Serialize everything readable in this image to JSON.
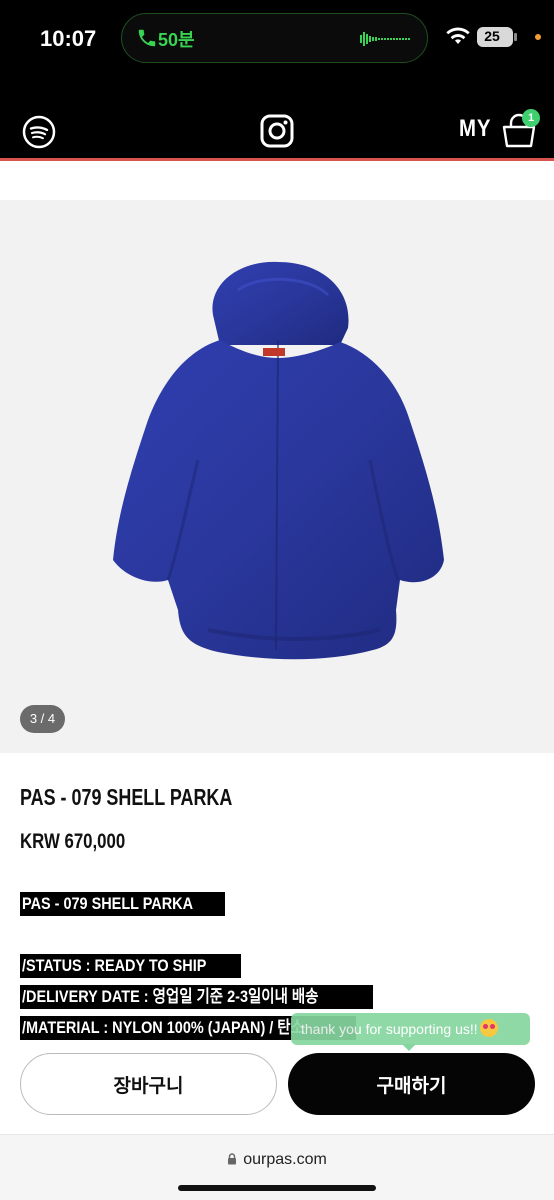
{
  "status_bar": {
    "time": "10:07",
    "call_duration": "50분",
    "battery": "25",
    "colors": {
      "call": "#39d353",
      "dot": "#f39c33"
    }
  },
  "header": {
    "my_label": "MY",
    "cart_count": "1",
    "icons": [
      "spotify-icon",
      "instagram-icon",
      "shopping-bag-icon"
    ]
  },
  "product": {
    "image_counter": "3 / 4",
    "title": "PAS - 079 SHELL PARKA",
    "price": "KRW 670,000",
    "description": {
      "line1": "PAS - 079 SHELL PARKA",
      "status": "/STATUS : READY TO SHIP",
      "delivery": "/DELIVERY DATE : 영업일 기준 2-3일이내  배송",
      "material": "/MATERIAL : NYLON 100% (JAPAN) / 탄소"
    },
    "color": "#2b3a9e"
  },
  "tooltip": {
    "text": "thank you for supporting us!!"
  },
  "actions": {
    "cart_label": "장바구니",
    "buy_label": "구매하기"
  },
  "browser": {
    "url": "ourpas.com"
  }
}
